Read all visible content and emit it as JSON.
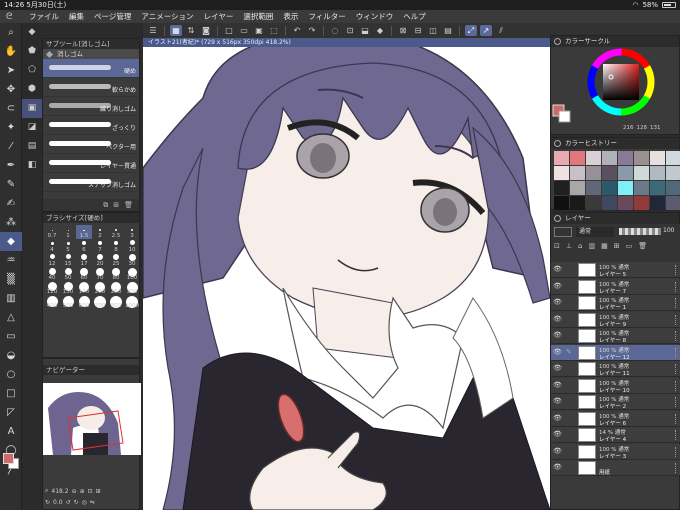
{
  "status_bar": {
    "time": "14:26",
    "date": "5月30日(土)",
    "battery": "58%",
    "battery_level": 0.58
  },
  "menu": [
    "ファイル",
    "編集",
    "ページ管理",
    "アニメーション",
    "レイヤー",
    "選択範囲",
    "表示",
    "フィルター",
    "ウィンドウ",
    "ヘルプ"
  ],
  "canvas": {
    "tab_label": "イラスト21(者紀)* (729 x 516px 350dpi 418.2%)"
  },
  "subtool_panel": {
    "title": "サブツール[消しゴム]",
    "tab": "消しゴム",
    "brushes": [
      {
        "label": "硬め",
        "color": "#cfd3ea"
      },
      {
        "label": "軟らかめ",
        "color": "#bbbbbb"
      },
      {
        "label": "練り消しゴム",
        "color": "#aaaaaa"
      },
      {
        "label": "ざっくり",
        "color": "#ffffff"
      },
      {
        "label": "ベクター用",
        "color": "#ffffff"
      },
      {
        "label": "レイヤー貫通",
        "color": "#ffffff"
      },
      {
        "label": "スナップ消しゴム",
        "color": "#ffffff"
      }
    ]
  },
  "size_panel": {
    "title": "ブラシサイズ[硬め]",
    "top_values": [
      "0.7",
      "1",
      "1.5",
      "2",
      "2.5",
      "3"
    ],
    "rows": [
      [
        "4",
        "5",
        "6",
        "7",
        "8",
        "10"
      ],
      [
        "12",
        "15",
        "17",
        "20",
        "25",
        "30"
      ],
      [
        "40",
        "50",
        "60",
        "70",
        "80",
        "100"
      ],
      [
        "120",
        "150",
        "170",
        "200",
        "250",
        "300"
      ],
      [
        "400",
        "500",
        "600",
        "700",
        "800",
        "1000"
      ]
    ]
  },
  "navigator": {
    "title": "ナビゲーター",
    "zoom": "418.2",
    "rotation": "0.0"
  },
  "color_circle": {
    "title": "カラーサークル",
    "h": "216",
    "s": "128",
    "v": "131"
  },
  "color_history": {
    "title": "カラーヒストリー",
    "colors": [
      "#e8aab0",
      "#e0787e",
      "#d8d0d4",
      "#b0b0b8",
      "#8a7a9a",
      "#9a9090",
      "#e8e0e0",
      "#d0d8e0",
      "#f0e0e0",
      "#c8c0c8",
      "#989098",
      "#5a5060",
      "#8a9aa8",
      "#d0d8d8",
      "#b0b8c0",
      "#c0c8d0",
      "#202020",
      "#a8a8a8",
      "#606878",
      "#2a5a6a",
      "#80f0f8",
      "#6a7a88",
      "#3a6a7a",
      "#506878",
      "#101010",
      "#1a1a1a",
      "#3a3a3a",
      "#404860",
      "#6a4a5a",
      "#903a3a",
      "#202838",
      "#5a5a70"
    ]
  },
  "layers": {
    "title": "レイヤー",
    "blend_mode": "通常",
    "opacity": "100",
    "rows": [
      {
        "mode": "100 % 通常",
        "name": "レイヤー 5"
      },
      {
        "mode": "100 % 通常",
        "name": "レイヤー 7"
      },
      {
        "mode": "100 % 通常",
        "name": "レイヤー 1"
      },
      {
        "mode": "100 % 通常",
        "name": "レイヤー 9"
      },
      {
        "mode": "100 % 通常",
        "name": "レイヤー 8"
      },
      {
        "mode": "100 % 通常",
        "name": "レイヤー 12"
      },
      {
        "mode": "100 % 通常",
        "name": "レイヤー 11"
      },
      {
        "mode": "100 % 通常",
        "name": "レイヤー 10"
      },
      {
        "mode": "100 % 通常",
        "name": "レイヤー 2"
      },
      {
        "mode": "100 % 通常",
        "name": "レイヤー 6"
      },
      {
        "mode": "14 % 通常",
        "name": "レイヤー 4"
      },
      {
        "mode": "100 % 通常",
        "name": "レイヤー 3"
      },
      {
        "mode": "",
        "name": "用紙"
      }
    ]
  }
}
